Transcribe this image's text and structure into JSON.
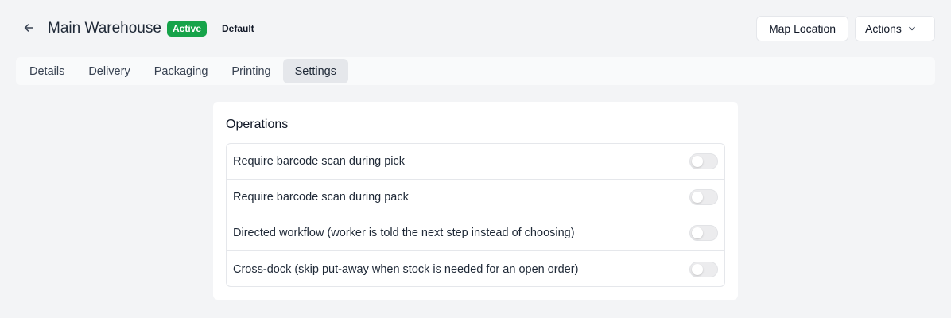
{
  "header": {
    "title": "Main Warehouse",
    "status_badge": "Active",
    "default_badge": "Default",
    "map_location_label": "Map Location",
    "actions_label": "Actions"
  },
  "tabs": [
    {
      "label": "Details",
      "active": false
    },
    {
      "label": "Delivery",
      "active": false
    },
    {
      "label": "Packaging",
      "active": false
    },
    {
      "label": "Printing",
      "active": false
    },
    {
      "label": "Settings",
      "active": true
    }
  ],
  "operations": {
    "title": "Operations",
    "settings": [
      {
        "label": "Require barcode scan during pick",
        "enabled": false
      },
      {
        "label": "Require barcode scan during pack",
        "enabled": false
      },
      {
        "label": "Directed workflow (worker is told the next step instead of choosing)",
        "enabled": false
      },
      {
        "label": "Cross-dock (skip put-away when stock is needed for an open order)",
        "enabled": false
      }
    ]
  },
  "colors": {
    "active_badge": "#16a34a",
    "background": "#f3f4f6",
    "active_tab": "#e5e7eb"
  },
  "icons": {
    "back": "arrow-left-icon",
    "actions_dropdown": "chevron-down-icon"
  }
}
